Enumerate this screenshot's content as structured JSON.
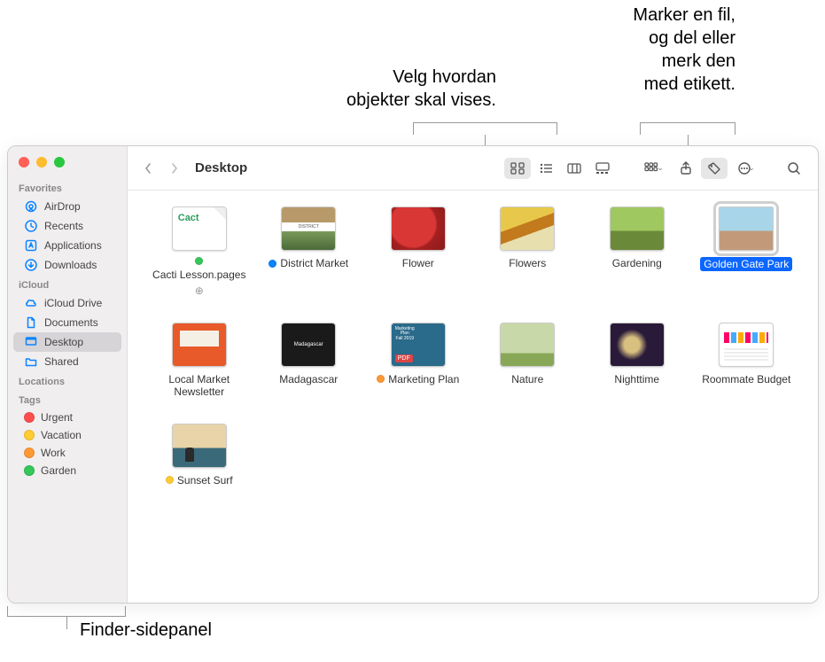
{
  "callouts": {
    "view": "Velg hvordan\nobjekter skal vises.",
    "share_tag": "Marker en fil,\nog del eller\nmerk den\nmed etikett.",
    "sidebar": "Finder-sidepanel"
  },
  "window": {
    "title": "Desktop"
  },
  "sidebar": {
    "favorites_heading": "Favorites",
    "favorites": [
      {
        "icon": "airdrop",
        "label": "AirDrop"
      },
      {
        "icon": "recents",
        "label": "Recents"
      },
      {
        "icon": "applications",
        "label": "Applications"
      },
      {
        "icon": "downloads",
        "label": "Downloads"
      }
    ],
    "icloud_heading": "iCloud",
    "icloud": [
      {
        "icon": "icloud",
        "label": "iCloud Drive",
        "selected": false
      },
      {
        "icon": "documents",
        "label": "Documents",
        "selected": false
      },
      {
        "icon": "desktop",
        "label": "Desktop",
        "selected": true
      },
      {
        "icon": "shared",
        "label": "Shared",
        "selected": false
      }
    ],
    "locations_heading": "Locations",
    "tags_heading": "Tags",
    "tags": [
      {
        "color": "#ff4d4d",
        "label": "Urgent"
      },
      {
        "color": "#ffcc33",
        "label": "Vacation"
      },
      {
        "color": "#ff9933",
        "label": "Work"
      },
      {
        "color": "#34c759",
        "label": "Garden"
      }
    ]
  },
  "files": [
    {
      "name": "Cacti Lesson.pages",
      "tag": "#34c759",
      "cloud": true,
      "thumb": "page",
      "selected": false
    },
    {
      "name": "District Market",
      "tag": "#0a84ff",
      "thumb": "district",
      "selected": false
    },
    {
      "name": "Flower",
      "thumb": "flower",
      "selected": false
    },
    {
      "name": "Flowers",
      "thumb": "flowers",
      "selected": false
    },
    {
      "name": "Gardening",
      "thumb": "gardening",
      "selected": false
    },
    {
      "name": "Golden Gate Park",
      "thumb": "golden",
      "selected": true
    },
    {
      "name": "Local Market Newsletter",
      "thumb": "local",
      "selected": false
    },
    {
      "name": "Madagascar",
      "thumb": "madagascar",
      "selected": false
    },
    {
      "name": "Marketing Plan",
      "tag": "#ff9933",
      "thumb": "marketing",
      "selected": false
    },
    {
      "name": "Nature",
      "thumb": "nature",
      "selected": false
    },
    {
      "name": "Nighttime",
      "thumb": "night",
      "selected": false
    },
    {
      "name": "Roommate Budget",
      "thumb": "roommate",
      "selected": false
    },
    {
      "name": "Sunset Surf",
      "tag": "#ffcc33",
      "thumb": "sunset",
      "selected": false
    }
  ]
}
